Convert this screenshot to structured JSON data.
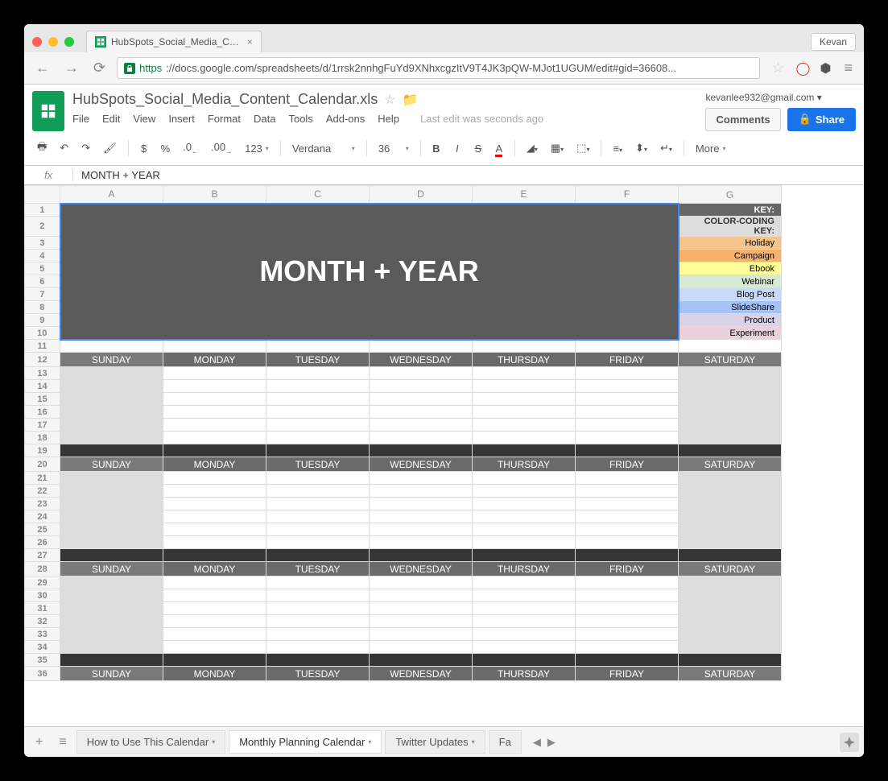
{
  "browser": {
    "tab_title": "HubSpots_Social_Media_C…",
    "user_badge": "Kevan",
    "url_https": "https",
    "url_rest": "://docs.google.com/spreadsheets/d/1rrsk2nnhgFuYd9XNhxcgzItV9T4JK3pQW-MJot1UGUM/edit#gid=36608..."
  },
  "docs": {
    "title": "HubSpots_Social_Media_Content_Calendar.xls",
    "menu": [
      "File",
      "Edit",
      "View",
      "Insert",
      "Format",
      "Data",
      "Tools",
      "Add-ons",
      "Help"
    ],
    "last_edit": "Last edit was seconds ago",
    "user_email": "kevanlee932@gmail.com",
    "comments": "Comments",
    "share": "Share"
  },
  "toolbar": {
    "currency": "$",
    "percent": "%",
    "dec_minus": ".0",
    "dec_plus": ".00",
    "format_123": "123",
    "font": "Verdana",
    "size": "36",
    "more": "More"
  },
  "formula": {
    "value": "MONTH + YEAR"
  },
  "sheet": {
    "columns": [
      "A",
      "B",
      "C",
      "D",
      "E",
      "F",
      "G"
    ],
    "title_cell": "MONTH + YEAR",
    "key": {
      "header1": "KEY:",
      "header2a": "COLOR-CODING",
      "header2b": "KEY:",
      "items": [
        {
          "label": "Holiday",
          "color": "#f4c58a"
        },
        {
          "label": "Campaign",
          "color": "#f6b26b"
        },
        {
          "label": "Ebook",
          "color": "#ffff99"
        },
        {
          "label": "Webinar",
          "color": "#d9ead3"
        },
        {
          "label": "Blog Post",
          "color": "#c9daf8"
        },
        {
          "label": "SlideShare",
          "color": "#a4c2f4"
        },
        {
          "label": "Product",
          "color": "#d9d2e9"
        },
        {
          "label": "Experiment",
          "color": "#ead1dc"
        }
      ]
    },
    "days": [
      "SUNDAY",
      "MONDAY",
      "TUESDAY",
      "WEDNESDAY",
      "THURSDAY",
      "FRIDAY",
      "SATURDAY"
    ]
  },
  "tabs": {
    "items": [
      "How to Use This Calendar",
      "Monthly Planning Calendar",
      "Twitter Updates",
      "Fa"
    ],
    "active_index": 1
  }
}
